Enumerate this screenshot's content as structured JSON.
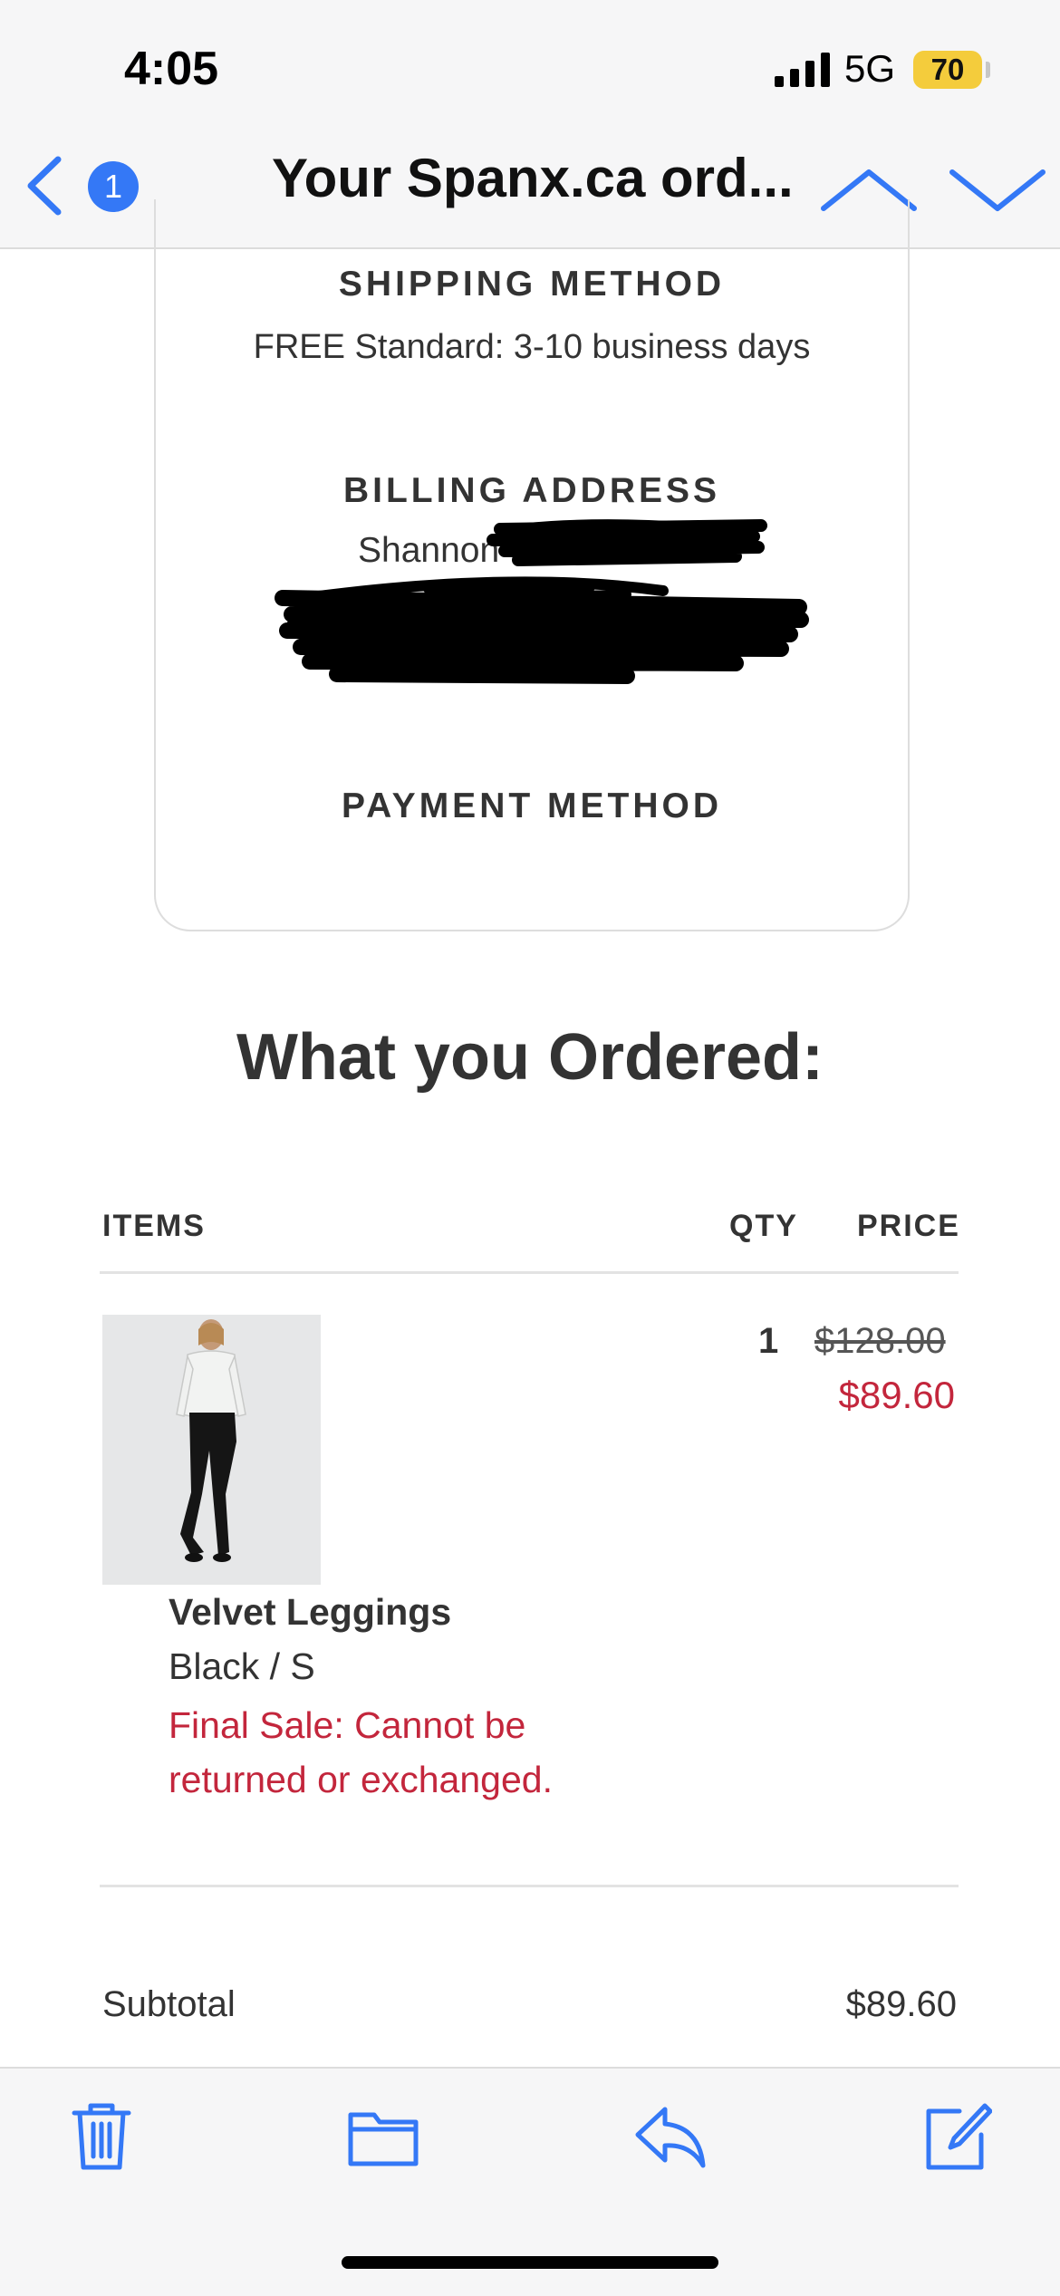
{
  "status_bar": {
    "time": "4:05",
    "network": "5G",
    "battery": "70"
  },
  "nav": {
    "unread_count": "1",
    "title": "Your Spanx.ca ord..."
  },
  "shipping": {
    "heading": "SHIPPING METHOD",
    "text": "FREE Standard: 3-10 business days"
  },
  "billing": {
    "heading": "BILLING ADDRESS",
    "name_visible": "Shannon"
  },
  "payment": {
    "heading": "PAYMENT METHOD"
  },
  "ordered_title": "What you Ordered:",
  "table": {
    "headers": {
      "items": "ITEMS",
      "qty": "QTY",
      "price": "PRICE"
    },
    "rows": [
      {
        "name": "Velvet Leggings",
        "variant": "Black / S",
        "note": "Final Sale: Cannot be returned or exchanged.",
        "qty": "1",
        "original_price": "$128.00",
        "sale_price": "$89.60"
      }
    ]
  },
  "summary": {
    "subtotal_label": "Subtotal",
    "subtotal_value": "$89.60"
  },
  "colors": {
    "accent": "#3478f6",
    "sale_red": "#c3263c",
    "battery": "#f4cc3c"
  },
  "icons": [
    "back-chevron-icon",
    "chevron-up-icon",
    "chevron-down-icon",
    "trash-icon",
    "folder-icon",
    "reply-icon",
    "compose-icon"
  ]
}
